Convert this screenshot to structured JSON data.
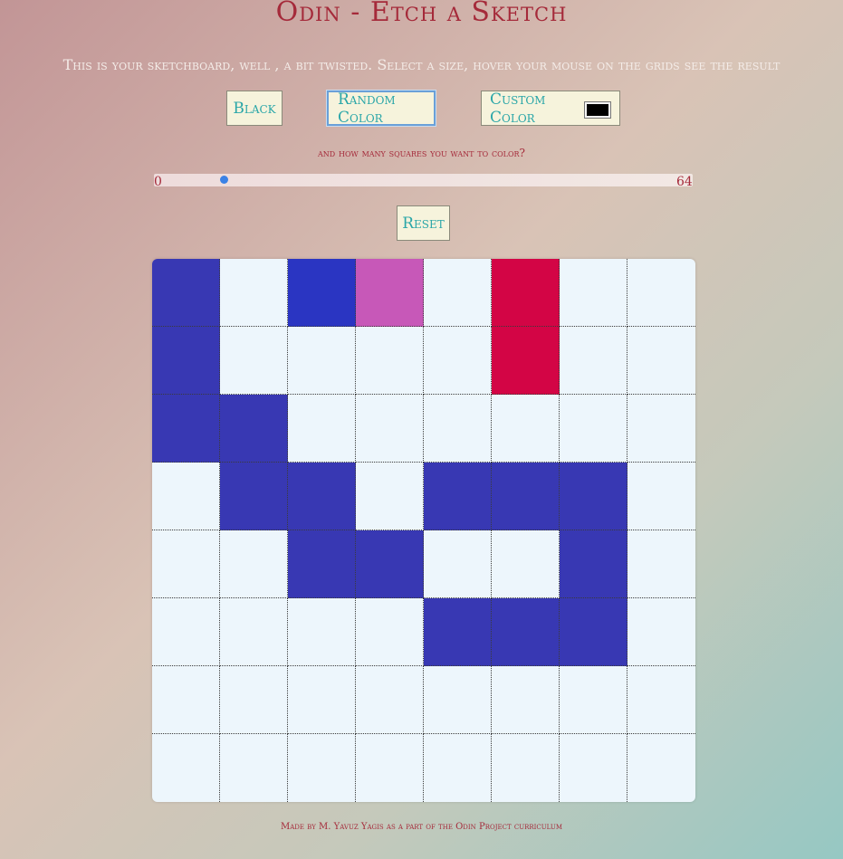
{
  "page": {
    "title": "Odin - Etch a Sketch",
    "subtitle": "This is your sketchboard, well , a bit twisted. Select a size, hover your mouse on the grids see the result",
    "question": "and how many squares you want to color?",
    "footer": "Made by M. Yavuz Yagis as a part of the Odin Project curriculum"
  },
  "controls": {
    "black_label": "Black",
    "random_label": "Random Color",
    "custom_label": "Custom Color",
    "custom_color": "#000000"
  },
  "slider": {
    "min_label": "0",
    "max_label": "64",
    "min": 0,
    "max": 64,
    "value": 8
  },
  "reset_label": "Reset",
  "colors": {
    "blank": "#edf6fc",
    "blue": "#3838b3",
    "royal": "#2a35c2",
    "pink": "#c758b8",
    "crimson": "#d30545"
  },
  "grid": {
    "size": 8,
    "cells": [
      [
        "blue",
        "blank",
        "royal",
        "pink",
        "blank",
        "crimson",
        "blank",
        "blank"
      ],
      [
        "blue",
        "blank",
        "blank",
        "blank",
        "blank",
        "crimson",
        "blank",
        "blank"
      ],
      [
        "blue",
        "blue",
        "blank",
        "blank",
        "blank",
        "blank",
        "blank",
        "blank"
      ],
      [
        "blank",
        "blue",
        "blue",
        "blank",
        "blue",
        "blue",
        "blue",
        "blank"
      ],
      [
        "blank",
        "blank",
        "blue",
        "blue",
        "blank",
        "blank",
        "blue",
        "blank"
      ],
      [
        "blank",
        "blank",
        "blank",
        "blank",
        "blue",
        "blue",
        "blue",
        "blank"
      ],
      [
        "blank",
        "blank",
        "blank",
        "blank",
        "blank",
        "blank",
        "blank",
        "blank"
      ],
      [
        "blank",
        "blank",
        "blank",
        "blank",
        "blank",
        "blank",
        "blank",
        "blank"
      ]
    ]
  }
}
